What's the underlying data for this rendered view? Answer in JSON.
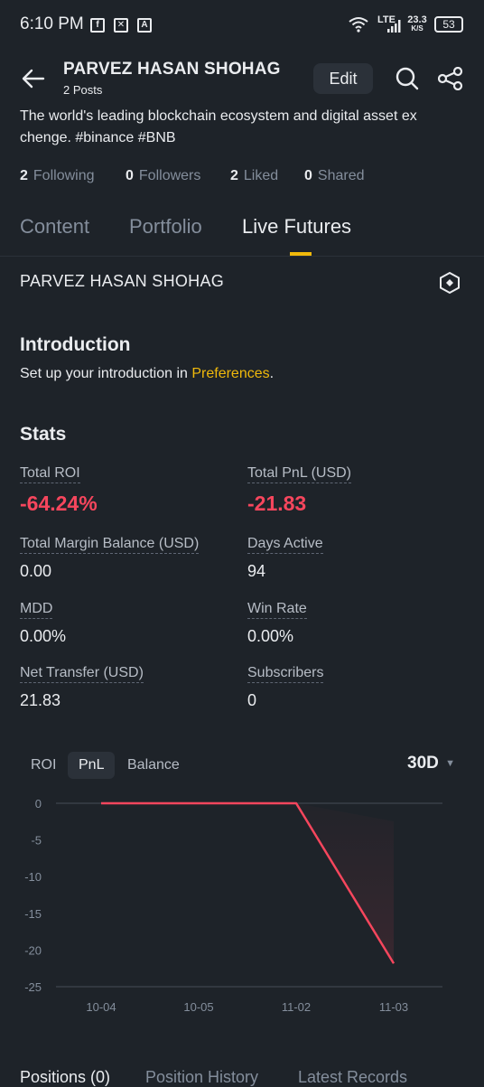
{
  "status_bar": {
    "time": "6:10 PM",
    "lte": "LTE",
    "speed_value": "23.3",
    "speed_unit": "K/S",
    "battery": "53"
  },
  "header": {
    "title": "PARVEZ HASAN SHOHAG",
    "posts": "2 Posts",
    "edit_label": "Edit",
    "bio": "The world's leading blockchain ecosystem and digital asset ex chenge. #binance #BNB"
  },
  "counts": [
    {
      "num": "2",
      "label": "Following"
    },
    {
      "num": "0",
      "label": "Followers"
    },
    {
      "num": "2",
      "label": "Liked"
    },
    {
      "num": "0",
      "label": "Shared"
    }
  ],
  "tabs": [
    "Content",
    "Portfolio",
    "Live Futures"
  ],
  "section": {
    "name": "PARVEZ HASAN SHOHAG",
    "intro_title": "Introduction",
    "intro_prefix": "Set up your introduction in ",
    "intro_link": "Preferences",
    "intro_suffix": ".",
    "stats_title": "Stats"
  },
  "stats": {
    "total_roi_label": "Total ROI",
    "total_roi_value": "-64.24%",
    "total_pnl_label": "Total PnL (USD)",
    "total_pnl_value": "-21.83",
    "margin_label": "Total Margin Balance (USD)",
    "margin_value": "0.00",
    "days_label": "Days Active",
    "days_value": "94",
    "mdd_label": "MDD",
    "mdd_value": "0.00%",
    "winrate_label": "Win Rate",
    "winrate_value": "0.00%",
    "net_label": "Net Transfer (USD)",
    "net_value": "21.83",
    "subs_label": "Subscribers",
    "subs_value": "0"
  },
  "chart_tabs": [
    "ROI",
    "PnL",
    "Balance"
  ],
  "period": "30D",
  "colors": {
    "negative": "#f6465d",
    "accent": "#f0b90b",
    "background": "#1e2329"
  },
  "chart_data": {
    "type": "line",
    "x": [
      "10-04",
      "10-05",
      "11-02",
      "11-03"
    ],
    "series": [
      {
        "values": [
          0,
          0,
          0,
          -21.83
        ]
      }
    ],
    "yticks": [
      0,
      -5,
      -10,
      -15,
      -20,
      -25
    ],
    "ylim": [
      -25,
      0
    ],
    "grid": false
  },
  "bottom_tabs": [
    "Positions (0)",
    "Position History",
    "Latest Records"
  ]
}
